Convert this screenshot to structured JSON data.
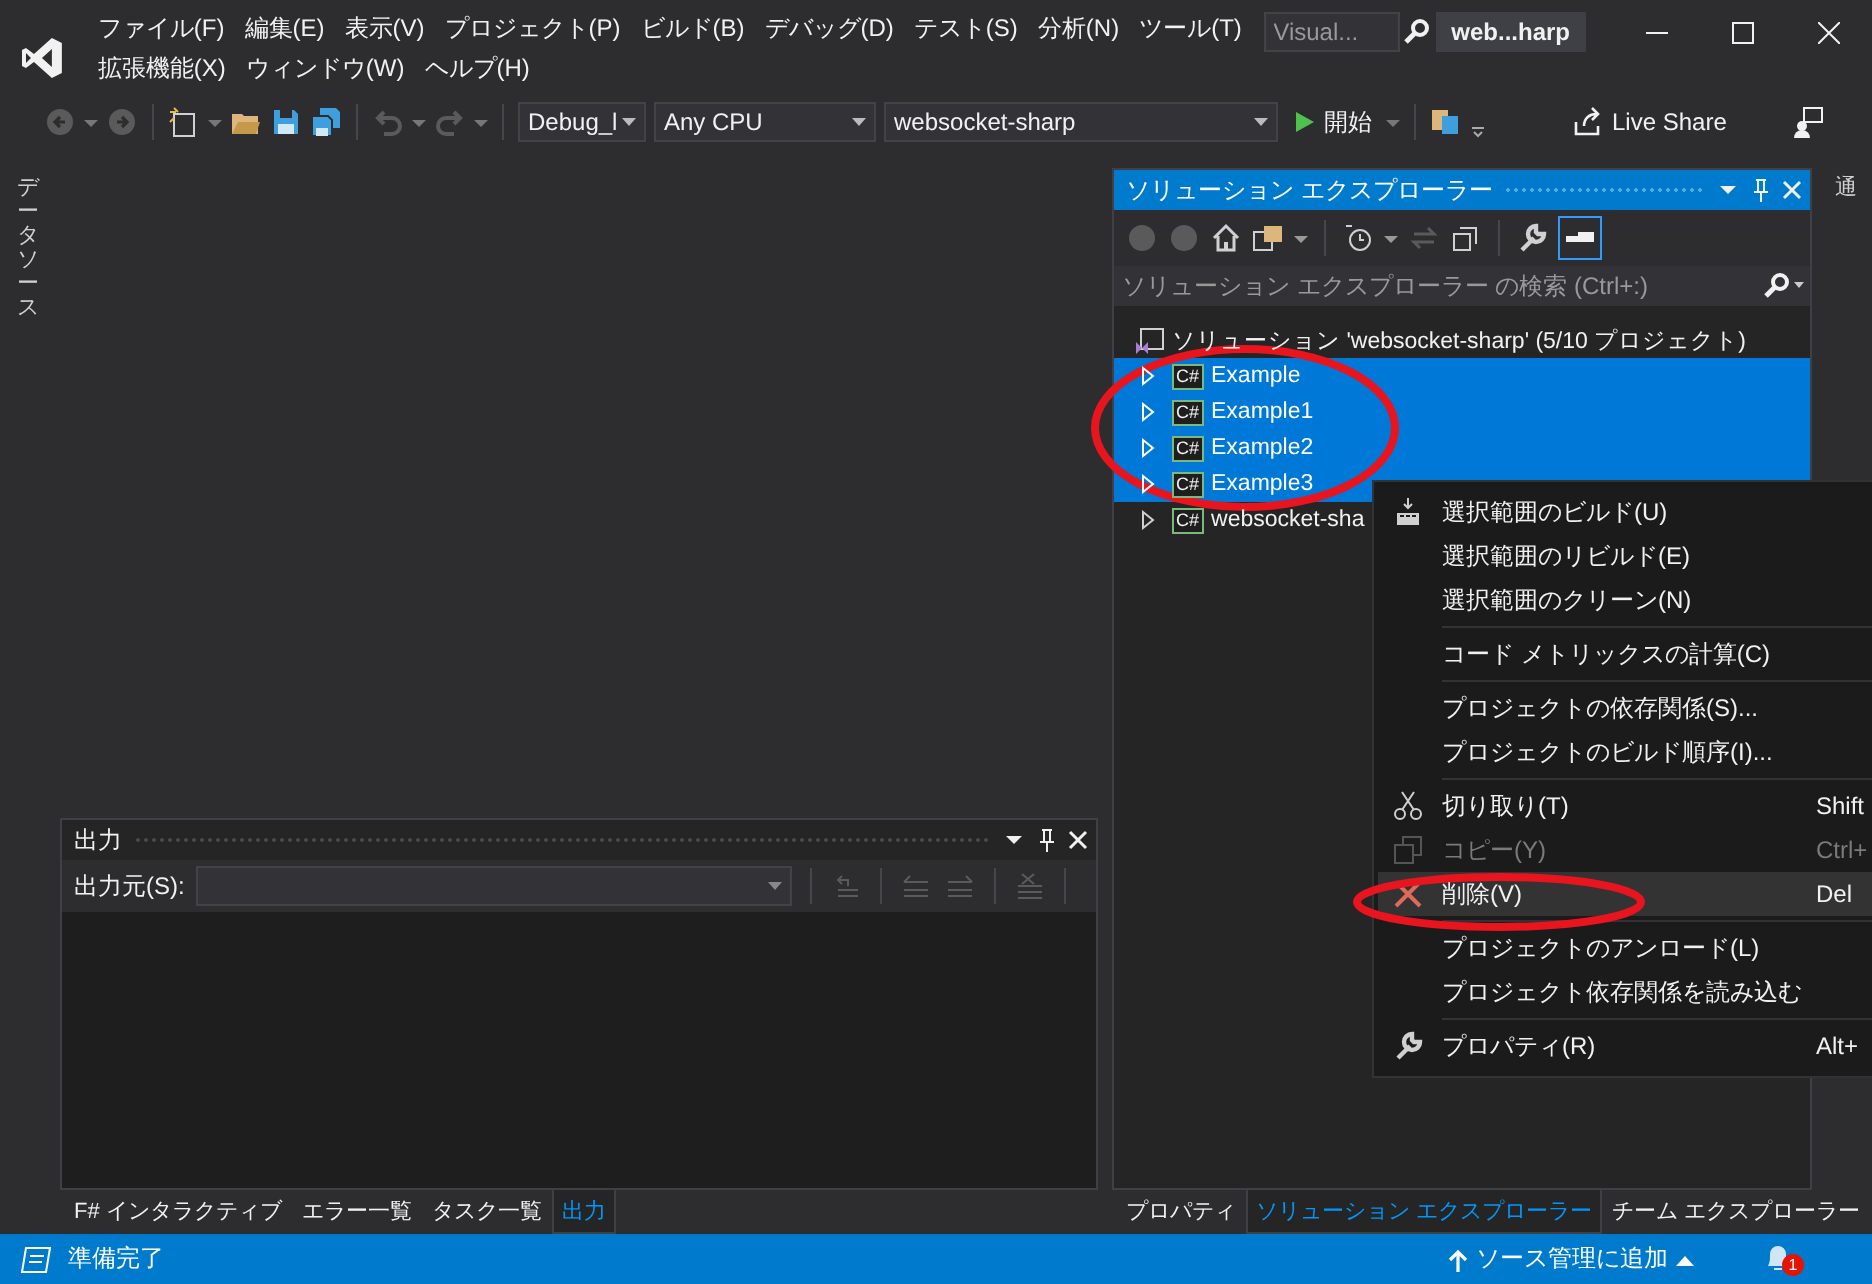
{
  "menu_bar": {
    "items": [
      "ファイル(F)",
      "編集(E)",
      "表示(V)",
      "プロジェクト(P)",
      "ビルド(B)",
      "デバッグ(D)",
      "テスト(S)",
      "分析(N)",
      "ツール(T)",
      "拡張機能(X)",
      "ウィンドウ(W)",
      "ヘルプ(H)"
    ]
  },
  "search": {
    "placeholder": "Visual..."
  },
  "title_badge": "web...harp",
  "toolbar": {
    "configuration": "Debug_l",
    "platform": "Any CPU",
    "startup_project": "websocket-sharp",
    "start_button": "開始",
    "live_share": "Live Share"
  },
  "left_tab": "データソース",
  "right_tab": "通",
  "solution_explorer": {
    "title": "ソリューション エクスプローラー",
    "search_placeholder": "ソリューション エクスプローラー の検索 (Ctrl+:)",
    "tree": [
      {
        "label": "ソリューション 'websocket-sharp' (5/10 プロジェクト)",
        "kind": "solution",
        "selected": false,
        "children": [
          {
            "label": "Example",
            "kind": "project",
            "language": "C#",
            "selected": true,
            "expanded": false
          },
          {
            "label": "Example1",
            "kind": "project",
            "language": "C#",
            "selected": true,
            "expanded": false
          },
          {
            "label": "Example2",
            "kind": "project",
            "language": "C#",
            "selected": true,
            "expanded": false
          },
          {
            "label": "Example3",
            "kind": "project",
            "language": "C#",
            "selected": true,
            "expanded": false
          },
          {
            "label": "websocket-sha",
            "kind": "project",
            "language": "C#",
            "selected": false,
            "expanded": false
          }
        ]
      }
    ]
  },
  "output": {
    "title": "出力",
    "source_label": "出力元(S):"
  },
  "left_tabs": [
    {
      "label": "F# インタラクティブ",
      "selected": false
    },
    {
      "label": "エラー一覧",
      "selected": false
    },
    {
      "label": "タスク一覧",
      "selected": false
    },
    {
      "label": "出力",
      "selected": true
    }
  ],
  "right_tabs": [
    {
      "label": "プロパティ",
      "selected": false
    },
    {
      "label": "ソリューション エクスプローラー",
      "selected": true
    },
    {
      "label": "チーム エクスプローラー",
      "selected": false
    }
  ],
  "context_menu": [
    {
      "kind": "item",
      "label": "選択範囲のビルド(U)",
      "disabled": false,
      "selected": false
    },
    {
      "kind": "item",
      "label": "選択範囲のリビルド(E)",
      "disabled": false,
      "selected": false
    },
    {
      "kind": "item",
      "label": "選択範囲のクリーン(N)",
      "disabled": false,
      "selected": false
    },
    {
      "kind": "separator"
    },
    {
      "kind": "item",
      "label": "コード メトリックスの計算(C)",
      "disabled": false,
      "selected": false
    },
    {
      "kind": "separator"
    },
    {
      "kind": "item",
      "label": "プロジェクトの依存関係(S)...",
      "disabled": false,
      "selected": false
    },
    {
      "kind": "item",
      "label": "プロジェクトのビルド順序(I)...",
      "disabled": false,
      "selected": false
    },
    {
      "kind": "separator"
    },
    {
      "kind": "item",
      "label": "切り取り(T)",
      "shortcut": "Shift",
      "disabled": false,
      "selected": false
    },
    {
      "kind": "item",
      "label": "コピー(Y)",
      "shortcut": "Ctrl+",
      "disabled": true,
      "selected": false
    },
    {
      "kind": "item",
      "label": "削除(V)",
      "shortcut": "Del",
      "disabled": false,
      "selected": true
    },
    {
      "kind": "separator"
    },
    {
      "kind": "item",
      "label": "プロジェクトのアンロード(L)",
      "disabled": false,
      "selected": false
    },
    {
      "kind": "item",
      "label": "プロジェクト依存関係を読み込む",
      "disabled": false,
      "selected": false
    },
    {
      "kind": "separator"
    },
    {
      "kind": "item",
      "label": "プロパティ(R)",
      "shortcut": "Alt+",
      "disabled": false,
      "selected": false
    }
  ],
  "status_bar": {
    "text": "準備完了",
    "source_control": "ソース管理に追加",
    "notifications": "1"
  }
}
